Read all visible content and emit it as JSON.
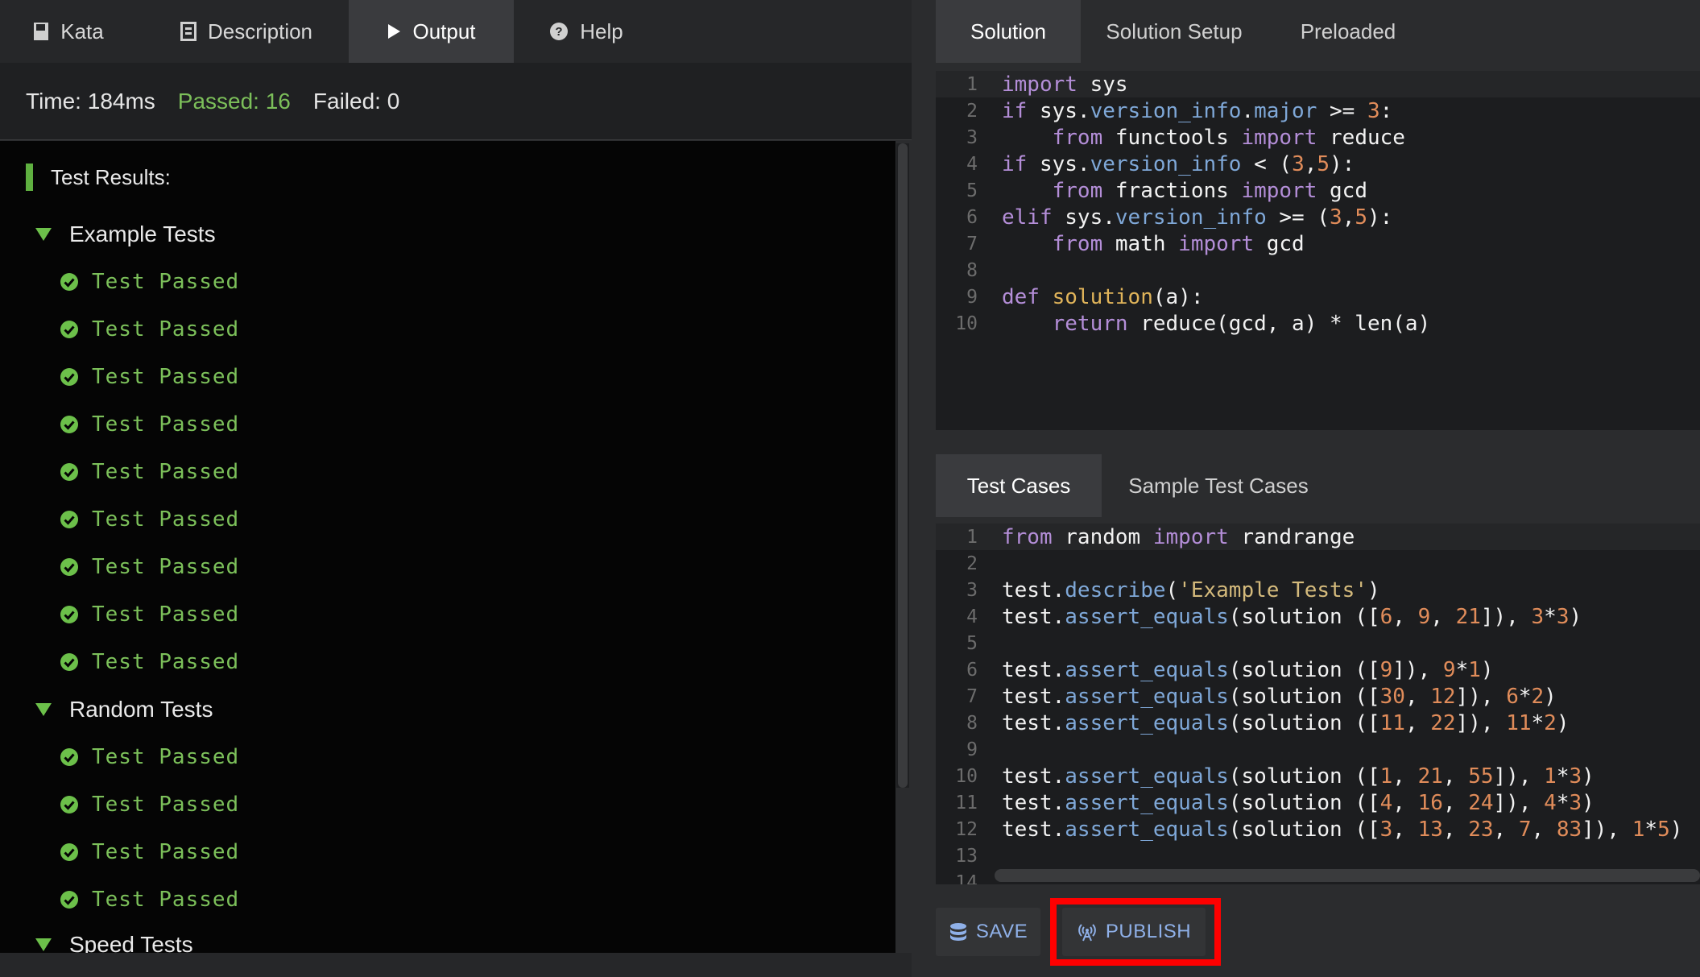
{
  "left_tabs": [
    {
      "label": "Kata",
      "icon": "book-icon"
    },
    {
      "label": "Description",
      "icon": "document-icon"
    },
    {
      "label": "Output",
      "icon": "play-icon",
      "active": true
    },
    {
      "label": "Help",
      "icon": "question-circle-icon"
    }
  ],
  "stats": {
    "time": "Time: 184ms",
    "passed": "Passed: 16",
    "failed": "Failed: 0"
  },
  "results": {
    "heading": "Test Results:",
    "groups": [
      {
        "name": "Example Tests",
        "tests": [
          "Test Passed",
          "Test Passed",
          "Test Passed",
          "Test Passed",
          "Test Passed",
          "Test Passed",
          "Test Passed",
          "Test Passed",
          "Test Passed"
        ]
      },
      {
        "name": "Random Tests",
        "tests": [
          "Test Passed",
          "Test Passed",
          "Test Passed",
          "Test Passed"
        ]
      },
      {
        "name": "Speed Tests",
        "tests": []
      }
    ]
  },
  "solution_tabs": [
    {
      "label": "Solution",
      "active": true
    },
    {
      "label": "Solution Setup"
    },
    {
      "label": "Preloaded"
    }
  ],
  "solution_lines": [
    "1",
    "2",
    "3",
    "4",
    "5",
    "6",
    "7",
    "8",
    "9",
    "10"
  ],
  "test_tabs": [
    {
      "label": "Test Cases",
      "active": true
    },
    {
      "label": "Sample Test Cases"
    }
  ],
  "test_lines": [
    "1",
    "2",
    "3",
    "4",
    "5",
    "6",
    "7",
    "8",
    "9",
    "10",
    "11",
    "12",
    "13",
    "14"
  ],
  "buttons": {
    "save": "SAVE",
    "publish": "PUBLISH"
  },
  "colors": {
    "accent_green": "#7cc05a",
    "button_text": "#8fb0e8",
    "highlight": "#ff0000"
  }
}
